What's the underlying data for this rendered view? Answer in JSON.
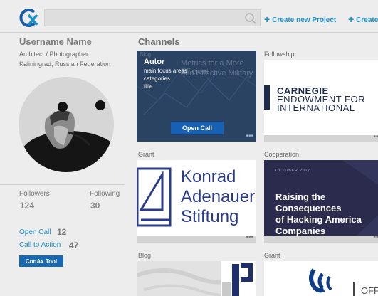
{
  "header": {
    "search_placeholder": "",
    "create_project": "Create new Project",
    "create_truncated": "Create"
  },
  "profile": {
    "username": "Username Name",
    "profession": "Architect / Photographer",
    "location": "Kaliningrad, Russian Federation",
    "followers_label": "Followers",
    "followers_count": "124",
    "following_label": "Following",
    "following_count": "30",
    "open_call_label": "Open Call",
    "open_call_count": "12",
    "call_to_action_label": "Call to Action",
    "call_to_action_count": "47",
    "tool_button": "ConAx Tool"
  },
  "channels": {
    "title": "Channels",
    "cards": [
      {
        "label": "",
        "overlay_tag": "Blog",
        "overlay_title": "Autor",
        "overlay_lines": [
          "main focus areas",
          "categories",
          "title"
        ],
        "bg_text_1": "Metrics for a More Efficient",
        "bg_text_2": "and Effective Military",
        "button": "Open Call"
      },
      {
        "label": "Followship",
        "logo_lines": [
          "CARNEGIE",
          "ENDOWMENT FOR",
          "INTERNATIONAL"
        ]
      },
      {
        "label": "Grant",
        "logo_lines": [
          "Konrad",
          "Adenauer",
          "Stiftung"
        ]
      },
      {
        "label": "Cooperation",
        "small_text": "OCTOBER 2017",
        "headline": [
          "Raising the",
          "Consequences",
          "of Hacking America",
          "Companies"
        ]
      },
      {
        "label": "Blog"
      },
      {
        "label": "Grant"
      }
    ],
    "menu_dots": "•••"
  },
  "colors": {
    "accent": "#1a8fc7",
    "button_blue": "#1769b3",
    "background": "#ededed"
  }
}
